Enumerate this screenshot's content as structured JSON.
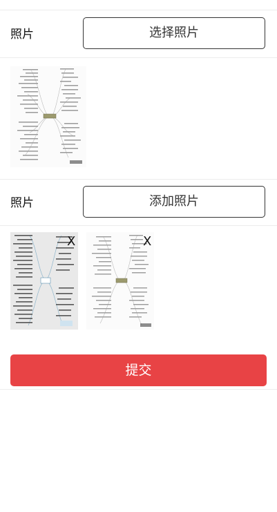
{
  "section1": {
    "label": "照片",
    "button_label": "选择照片"
  },
  "section2": {
    "label": "照片",
    "button_label": "添加照片",
    "remove_label": "X"
  },
  "form": {
    "submit_label": "提交"
  },
  "colors": {
    "submit_bg": "#e84345",
    "border": "#333333",
    "divider": "#ececec"
  },
  "icons": {
    "mindmap_image": "mindmap-thumbnail",
    "remove": "close-icon"
  }
}
